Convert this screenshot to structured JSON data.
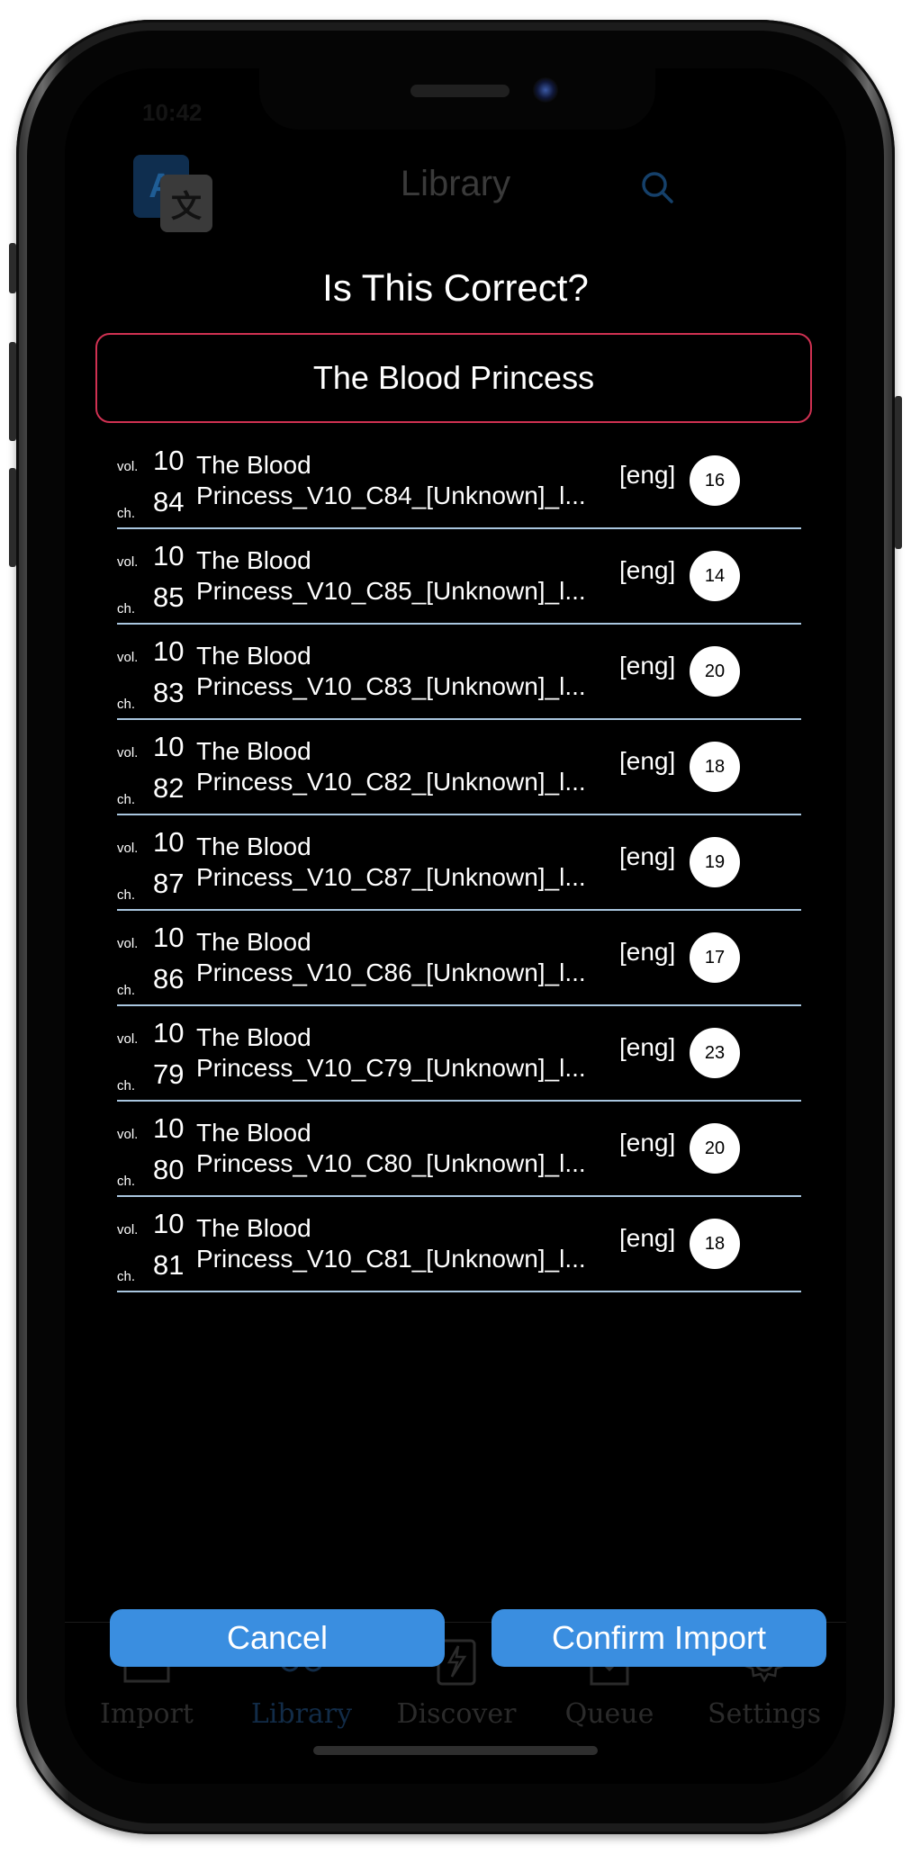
{
  "status_bar": {
    "time": "10:42",
    "right": "◦ ▭"
  },
  "background": {
    "title": "Library",
    "logo_letters": {
      "a": "A",
      "b": "文"
    },
    "tabs": [
      {
        "label": "Import",
        "icon": "folder-icon"
      },
      {
        "label": "Library",
        "icon": "glasses-icon"
      },
      {
        "label": "Discover",
        "icon": "discover-icon"
      },
      {
        "label": "Queue",
        "icon": "download-icon"
      },
      {
        "label": "Settings",
        "icon": "gear-icon"
      }
    ]
  },
  "modal": {
    "title": "Is This Correct?",
    "series_name": "The Blood Princess",
    "vol_label": "vol.",
    "ch_label": "ch.",
    "chapters": [
      {
        "vol": "10",
        "ch": "84",
        "line1": "The Blood",
        "line2": "Princess_V10_C84_[Unknown]_l...",
        "lang": "[eng]",
        "count": "16"
      },
      {
        "vol": "10",
        "ch": "85",
        "line1": "The Blood",
        "line2": "Princess_V10_C85_[Unknown]_l...",
        "lang": "[eng]",
        "count": "14"
      },
      {
        "vol": "10",
        "ch": "83",
        "line1": "The Blood",
        "line2": "Princess_V10_C83_[Unknown]_l...",
        "lang": "[eng]",
        "count": "20"
      },
      {
        "vol": "10",
        "ch": "82",
        "line1": "The Blood",
        "line2": "Princess_V10_C82_[Unknown]_l...",
        "lang": "[eng]",
        "count": "18"
      },
      {
        "vol": "10",
        "ch": "87",
        "line1": "The Blood",
        "line2": "Princess_V10_C87_[Unknown]_l...",
        "lang": "[eng]",
        "count": "19"
      },
      {
        "vol": "10",
        "ch": "86",
        "line1": "The Blood",
        "line2": "Princess_V10_C86_[Unknown]_l...",
        "lang": "[eng]",
        "count": "17"
      },
      {
        "vol": "10",
        "ch": "79",
        "line1": "The Blood",
        "line2": "Princess_V10_C79_[Unknown]_l...",
        "lang": "[eng]",
        "count": "23"
      },
      {
        "vol": "10",
        "ch": "80",
        "line1": "The Blood",
        "line2": "Princess_V10_C80_[Unknown]_l...",
        "lang": "[eng]",
        "count": "20"
      },
      {
        "vol": "10",
        "ch": "81",
        "line1": "The Blood",
        "line2": "Princess_V10_C81_[Unknown]_l...",
        "lang": "[eng]",
        "count": "18"
      }
    ],
    "cancel_label": "Cancel",
    "confirm_label": "Confirm Import"
  },
  "colors": {
    "accent": "#3a8ee0",
    "field_border": "#d03152",
    "divider": "#a9c6df"
  }
}
